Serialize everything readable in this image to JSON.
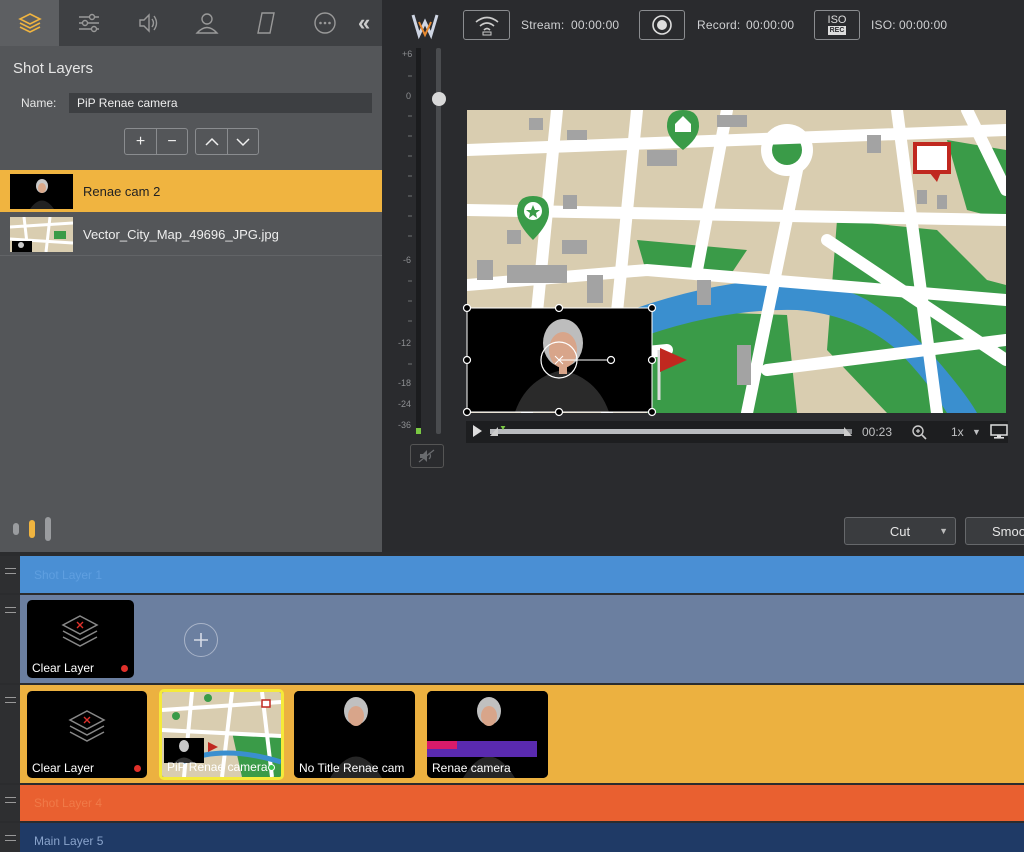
{
  "left_panel": {
    "section_title": "Shot Layers",
    "name_label": "Name:",
    "name_value": "PiP Renae camera",
    "add_symbol": "+",
    "remove_symbol": "−",
    "layers": [
      {
        "label": "Renae cam 2",
        "selected": true
      },
      {
        "label": "Vector_City_Map_49696_JPG.jpg",
        "selected": false
      }
    ],
    "toolbar_icons": [
      "layers-icon",
      "sliders-icon",
      "audio-icon",
      "person-icon",
      "parallelogram-icon",
      "more-icon"
    ],
    "collapse_symbol": "«"
  },
  "topbar": {
    "stream_label": "Stream:",
    "stream_time": "00:00:00",
    "record_label": "Record:",
    "record_time": "00:00:00",
    "iso_label": "ISO:",
    "iso_time": "00:00:00",
    "iso_badge_top": "ISO",
    "iso_badge_bottom": "REC"
  },
  "meter": {
    "ticks": [
      "+6",
      "0",
      "-6",
      "-12",
      "-18",
      "-24",
      "-36"
    ]
  },
  "transport": {
    "time": "00:23",
    "speed": "1x",
    "progress": 0.98
  },
  "transitions": {
    "cut_label": "Cut",
    "smooth_label": "Smoo"
  },
  "layers": {
    "shot_layer_1": "Shot Layer 1",
    "main_layer_5": "Main Layer 5",
    "shot_layer_4": "Shot Layer 4",
    "row2_tiles": [
      {
        "label": "Clear Layer",
        "dot": "#e0302a"
      }
    ],
    "row3_tiles": [
      {
        "label": "Clear Layer",
        "dot": "#e0302a"
      },
      {
        "label": "PiP Renae camera",
        "dot": "#39c24a"
      },
      {
        "label": "No Title Renae cam",
        "dot": ""
      },
      {
        "label": "Renae camera",
        "dot": ""
      }
    ]
  },
  "colors": {
    "accent": "#f0b440",
    "band_blue": "#4a8fd4",
    "band_slate": "#6b7fa0",
    "band_orange": "#e96030",
    "band_navy": "#1f3a66",
    "map_road": "#ffffff",
    "map_park": "#3a9b48",
    "map_river": "#3a8fcf"
  }
}
